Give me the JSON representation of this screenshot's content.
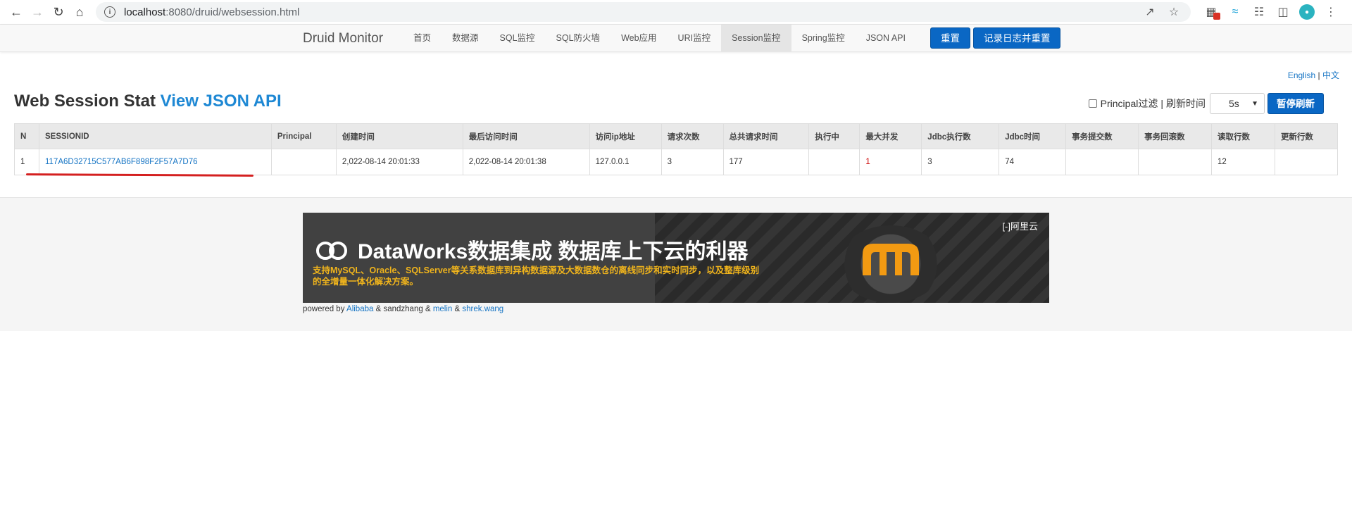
{
  "browser": {
    "url_host": "localhost",
    "url_rest": ":8080/druid/websession.html"
  },
  "navbar": {
    "brand": "Druid Monitor",
    "items": [
      "首页",
      "数据源",
      "SQL监控",
      "SQL防火墙",
      "Web应用",
      "URI监控",
      "Session监控",
      "Spring监控",
      "JSON API"
    ],
    "active_index": 6,
    "reset_label": "重置",
    "log_reset_label": "记录日志并重置"
  },
  "lang": {
    "english": "English",
    "sep": "|",
    "chinese": "中文"
  },
  "page": {
    "title": "Web Session Stat",
    "api_link": "View JSON API"
  },
  "controls": {
    "principal_filter": "Principal过滤",
    "sep": "|",
    "refresh_label": "刷新时间",
    "refresh_value": "5s",
    "pause_label": "暂停刷新"
  },
  "table": {
    "headers": [
      "N",
      "SESSIONID",
      "Principal",
      "创建时间",
      "最后访问时间",
      "访问ip地址",
      "请求次数",
      "总共请求时间",
      "执行中",
      "最大并发",
      "Jdbc执行数",
      "Jdbc时间",
      "事务提交数",
      "事务回滚数",
      "读取行数",
      "更新行数"
    ],
    "rows": [
      [
        "1",
        "117A6D32715C577AB6F898F2F57A7D76",
        "",
        "2,022-08-14 20:01:33",
        "2,022-08-14 20:01:38",
        "127.0.0.1",
        "3",
        "177",
        "",
        "1",
        "3",
        "74",
        "",
        "",
        "12",
        ""
      ]
    ]
  },
  "banner": {
    "headline": "DataWorks数据集成 数据库上下云的利器",
    "sub": "支持MySQL、Oracle、SQLServer等关系数据库到异构数据源及大数据数仓的离线同步和实时同步，以及整库级别的全增量一体化解决方案。",
    "vendor": "[-]阿里云"
  },
  "footer": {
    "powered_by": "powered by",
    "alibaba": "Alibaba",
    "amp1": "& sandzhang &",
    "melin": "melin",
    "amp2": "&",
    "shrek": "shrek.wang"
  },
  "colors": {
    "accent": "#0a67c4",
    "link": "#1e88d4",
    "banner_sub": "#f0b41c",
    "underline": "#d42020"
  }
}
